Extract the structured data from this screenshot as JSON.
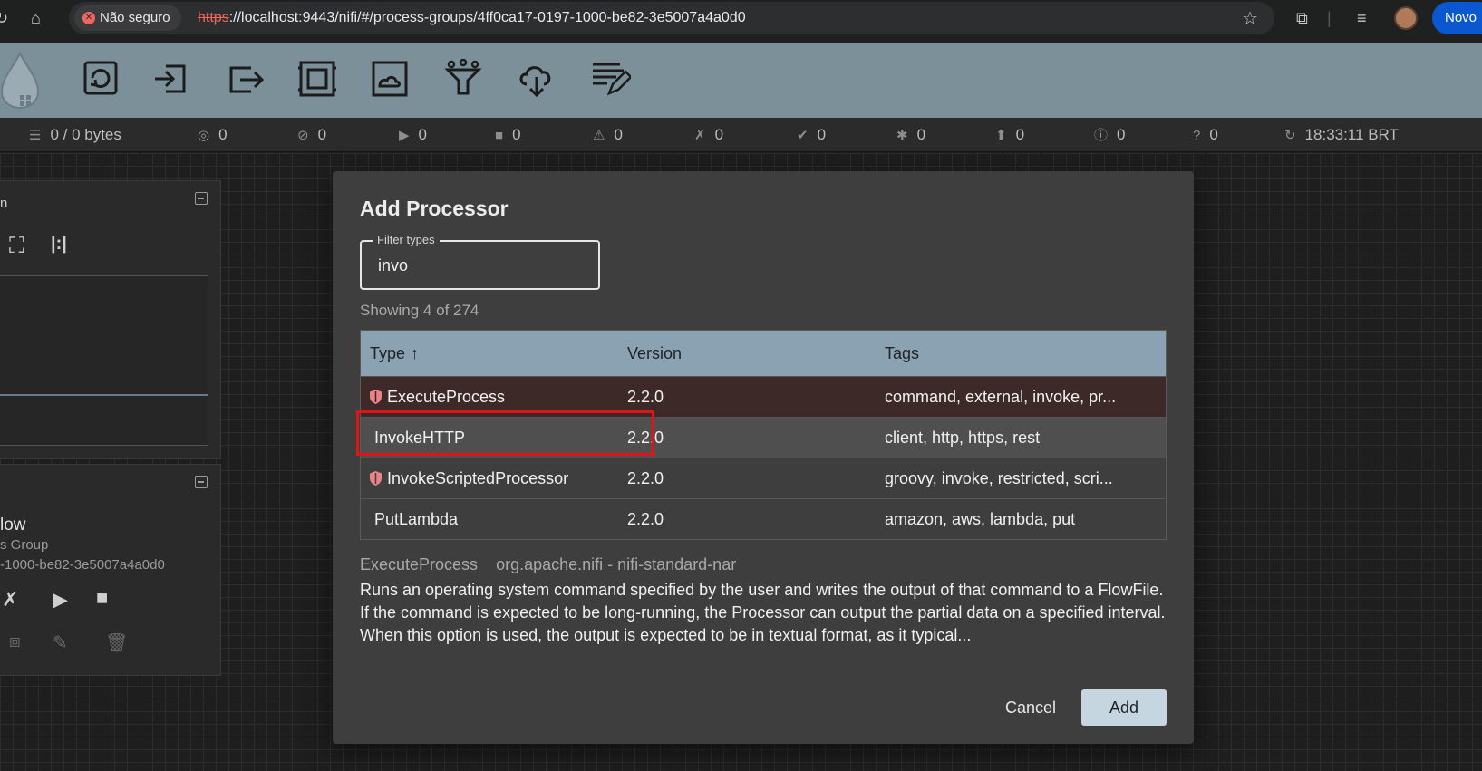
{
  "browser": {
    "security_label": "Não seguro",
    "url_scheme": "https",
    "url_rest": "://localhost:9443/nifi/#/process-groups/4ff0ca17-0197-1000-be82-3e5007a4a0d0",
    "novo_label": "Novo"
  },
  "toolbar": {
    "tools": [
      "processor-icon",
      "input-port-icon",
      "output-port-icon",
      "process-group-icon",
      "remote-process-group-icon",
      "funnel-icon",
      "template-icon",
      "label-icon"
    ]
  },
  "status": {
    "queued": "0 / 0 bytes",
    "transmitting": "0",
    "not_transmitting": "0",
    "running": "0",
    "stopped": "0",
    "invalid": "0",
    "disabled": "0",
    "up_to_date": "0",
    "locally_modified": "0",
    "stale": "0",
    "sync_failure": "0",
    "unknown": "0",
    "refreshed": "18:33:11 BRT"
  },
  "navigate_panel": {
    "title": "n"
  },
  "operate_panel": {
    "name": "low",
    "type": "s Group",
    "id": "-1000-be82-3e5007a4a0d0"
  },
  "dialog": {
    "title": "Add Processor",
    "filter_label": "Filter types",
    "filter_value": "invo",
    "showing": "Showing 4 of 274",
    "columns": {
      "type": "Type",
      "version": "Version",
      "tags": "Tags"
    },
    "rows": [
      {
        "type": "ExecuteProcess",
        "version": "2.2.0",
        "tags": "command, external, invoke, pr...",
        "restricted": true
      },
      {
        "type": "InvokeHTTP",
        "version": "2.2.0",
        "tags": "client, http, https, rest",
        "restricted": false
      },
      {
        "type": "InvokeScriptedProcessor",
        "version": "2.2.0",
        "tags": "groovy, invoke, restricted, scri...",
        "restricted": true
      },
      {
        "type": "PutLambda",
        "version": "2.2.0",
        "tags": "amazon, aws, lambda, put",
        "restricted": false
      }
    ],
    "selected_type": "ExecuteProcess",
    "selected_bundle": "org.apache.nifi - nifi-standard-nar",
    "selected_description": "Runs an operating system command specified by the user and writes the output of that command to a FlowFile. If the command is expected to be long-running, the Processor can output the partial data on a specified interval. When this option is used, the output is expected to be in textual format, as it typical...",
    "cancel_label": "Cancel",
    "add_label": "Add"
  },
  "colors": {
    "toolbar_bg": "#7c909a",
    "table_header": "#8aa2b1",
    "selected_row": "#3d2a28",
    "add_button": "#c6d6e0",
    "highlight": "#e01616"
  }
}
